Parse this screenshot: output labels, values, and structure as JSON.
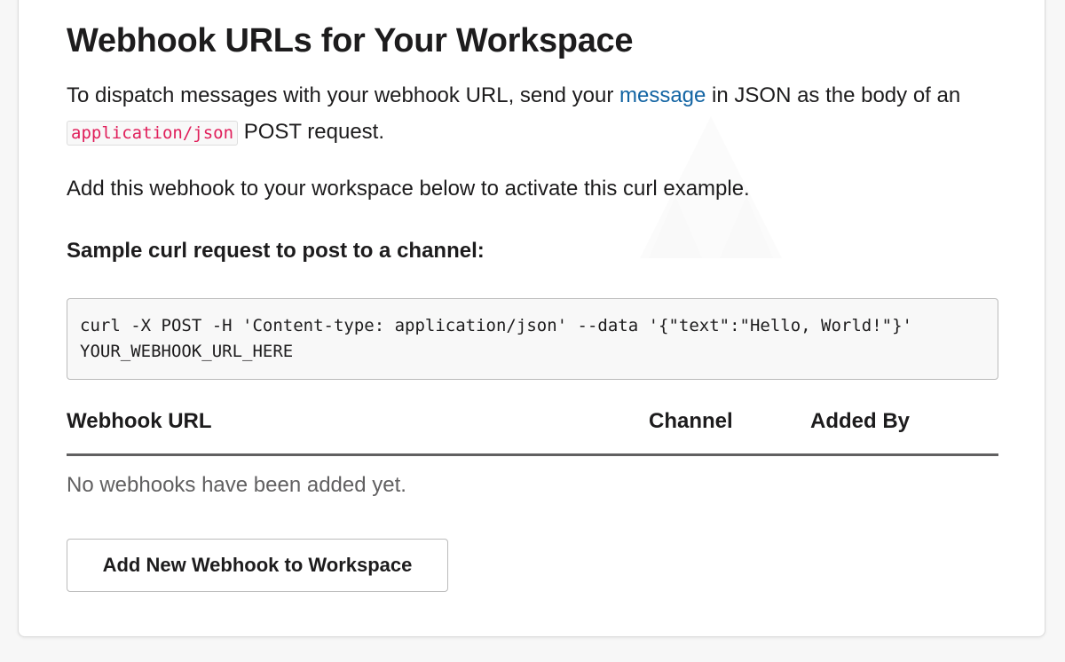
{
  "page": {
    "title": "Webhook URLs for Your Workspace"
  },
  "intro": {
    "part1": "To dispatch messages with your webhook URL, send your ",
    "link_text": "message",
    "part2": " in JSON as the body of an ",
    "code": "application/json",
    "part3": " POST request."
  },
  "activate_text": "Add this webhook to your workspace below to activate this curl example.",
  "sample": {
    "heading": "Sample curl request to post to a channel:",
    "code": "curl -X POST -H 'Content-type: application/json' --data '{\"text\":\"Hello, World!\"}' YOUR_WEBHOOK_URL_HERE"
  },
  "table": {
    "columns": [
      "Webhook URL",
      "Channel",
      "Added By"
    ],
    "empty_text": "No webhooks have been added yet."
  },
  "add_button_label": "Add New Webhook to Workspace",
  "colors": {
    "link": "#1264a3",
    "inline_code": "#e01e5a",
    "header_rule": "#616061"
  }
}
